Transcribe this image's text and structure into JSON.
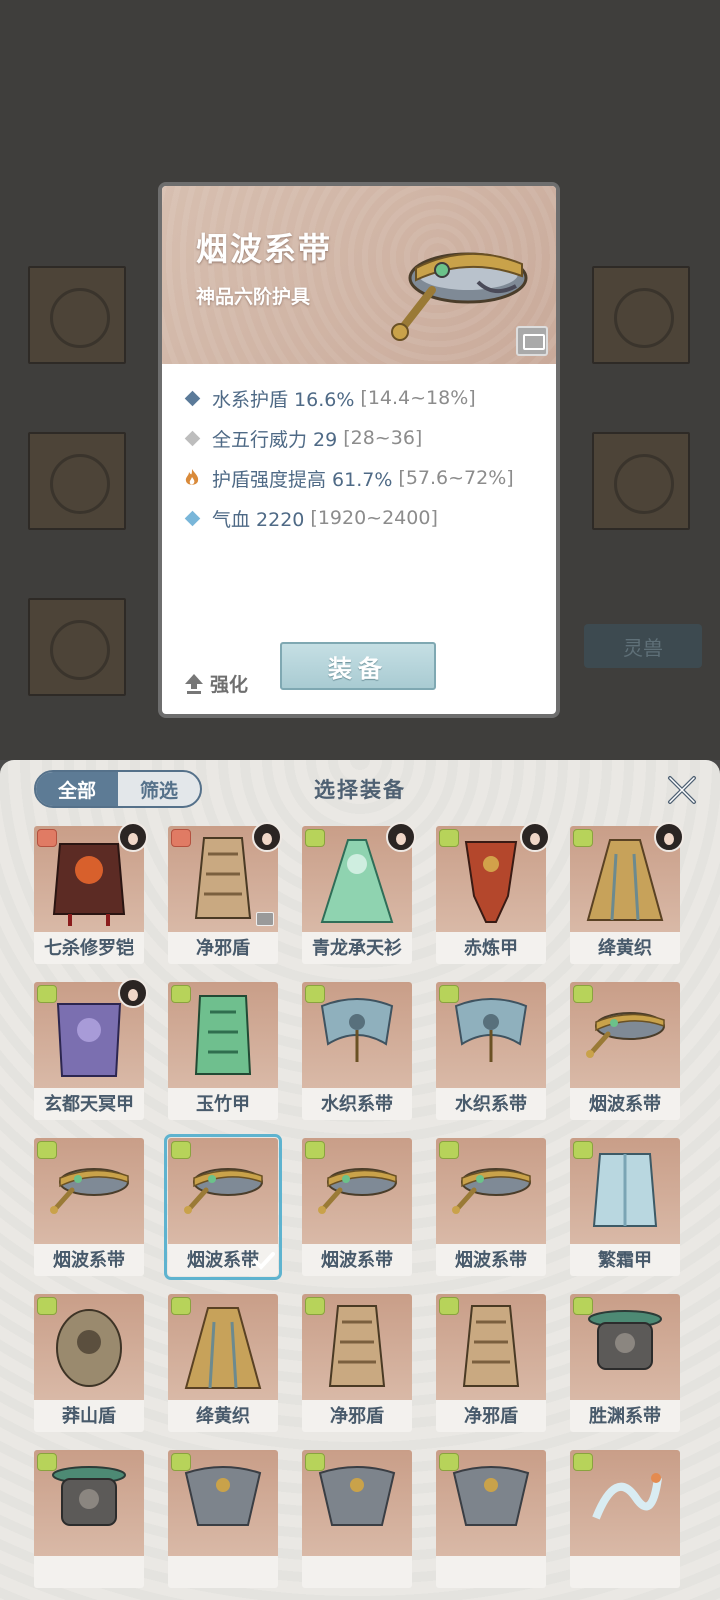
{
  "background": {
    "tag_label": "灵兽"
  },
  "detail": {
    "name": "烟波系带",
    "grade": "神品六阶护具",
    "stats": [
      {
        "icon": "blue-diamond-icon",
        "color": "#5b7a99",
        "text": "水系护盾 16.6%",
        "range": "[14.4~18%]"
      },
      {
        "icon": "gray-diamond-icon",
        "color": "#bdbdbd",
        "text": "全五行威力 29",
        "range": "[28~36]"
      },
      {
        "icon": "flame-icon",
        "color": "#d98a3a",
        "text": "护盾强度提高 61.7%",
        "range": "[57.6~72%]"
      },
      {
        "icon": "lightblue-diamond-icon",
        "color": "#79b6d9",
        "text": "气血 2220",
        "range": "[1920~2400]"
      }
    ],
    "enhance_label": "强化",
    "equip_label": "装备"
  },
  "sheet": {
    "title": "选择装备",
    "tabs": [
      {
        "label": "全部",
        "active": true
      },
      {
        "label": "筛选",
        "active": false
      }
    ],
    "items": [
      {
        "label": "七杀修罗铠",
        "badge": "red",
        "avatar": true,
        "lock": false,
        "selected": false,
        "art": "armor-dark"
      },
      {
        "label": "净邪盾",
        "badge": "red",
        "avatar": true,
        "lock": true,
        "selected": false,
        "art": "armor-gold"
      },
      {
        "label": "青龙承天衫",
        "badge": "green",
        "avatar": true,
        "lock": false,
        "selected": false,
        "art": "robe-green"
      },
      {
        "label": "赤炼甲",
        "badge": "green",
        "avatar": true,
        "lock": false,
        "selected": false,
        "art": "armor-red"
      },
      {
        "label": "绛黄织",
        "badge": "green",
        "avatar": true,
        "lock": false,
        "selected": false,
        "art": "cape-gold"
      },
      {
        "label": "玄都天冥甲",
        "badge": "green",
        "avatar": true,
        "lock": false,
        "selected": false,
        "art": "armor-purple"
      },
      {
        "label": "玉竹甲",
        "badge": "green",
        "avatar": false,
        "lock": false,
        "selected": false,
        "art": "armor-jade"
      },
      {
        "label": "水织系带",
        "badge": "green",
        "avatar": false,
        "lock": false,
        "selected": false,
        "art": "belt-blue"
      },
      {
        "label": "水织系带",
        "badge": "green",
        "avatar": false,
        "lock": false,
        "selected": false,
        "art": "belt-blue"
      },
      {
        "label": "烟波系带",
        "badge": "green",
        "avatar": false,
        "lock": false,
        "selected": false,
        "art": "belt-gold"
      },
      {
        "label": "烟波系带",
        "badge": "green",
        "avatar": false,
        "lock": false,
        "selected": false,
        "art": "belt-gold"
      },
      {
        "label": "烟波系带",
        "badge": "green",
        "avatar": false,
        "lock": false,
        "selected": true,
        "art": "belt-gold"
      },
      {
        "label": "烟波系带",
        "badge": "green",
        "avatar": false,
        "lock": false,
        "selected": false,
        "art": "belt-gold"
      },
      {
        "label": "烟波系带",
        "badge": "green",
        "avatar": false,
        "lock": false,
        "selected": false,
        "art": "belt-gold"
      },
      {
        "label": "繁霜甲",
        "badge": "green",
        "avatar": false,
        "lock": false,
        "selected": false,
        "art": "armor-ice"
      },
      {
        "label": "莽山盾",
        "badge": "green",
        "avatar": false,
        "lock": false,
        "selected": false,
        "art": "armor-bronze"
      },
      {
        "label": "绛黄织",
        "badge": "green",
        "avatar": false,
        "lock": false,
        "selected": false,
        "art": "cape-gold"
      },
      {
        "label": "净邪盾",
        "badge": "green",
        "avatar": false,
        "lock": false,
        "selected": false,
        "art": "armor-gold"
      },
      {
        "label": "净邪盾",
        "badge": "green",
        "avatar": false,
        "lock": false,
        "selected": false,
        "art": "armor-gold"
      },
      {
        "label": "胜渊系带",
        "badge": "green",
        "avatar": false,
        "lock": false,
        "selected": false,
        "art": "belt-dark"
      },
      {
        "label": "",
        "badge": "green",
        "avatar": false,
        "lock": false,
        "selected": false,
        "art": "belt-dark"
      },
      {
        "label": "",
        "badge": "green",
        "avatar": false,
        "lock": false,
        "selected": false,
        "art": "belt-gray"
      },
      {
        "label": "",
        "badge": "green",
        "avatar": false,
        "lock": false,
        "selected": false,
        "art": "belt-gray"
      },
      {
        "label": "",
        "badge": "green",
        "avatar": false,
        "lock": false,
        "selected": false,
        "art": "belt-gray"
      },
      {
        "label": "",
        "badge": "green",
        "avatar": false,
        "lock": false,
        "selected": false,
        "art": "dragon-white"
      }
    ]
  }
}
